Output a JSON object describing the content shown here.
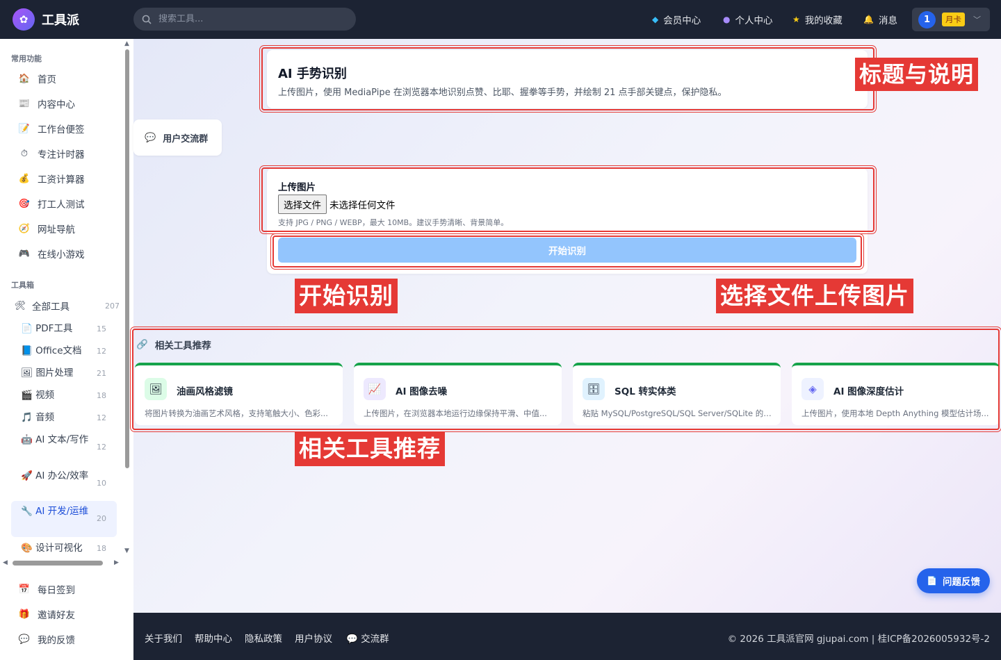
{
  "header": {
    "logo_text": "工具派",
    "search_placeholder": "搜索工具...",
    "nav": [
      {
        "label": "会员中心",
        "icon": "diamond-icon"
      },
      {
        "label": "个人中心",
        "icon": "user-icon"
      },
      {
        "label": "我的收藏",
        "icon": "star-icon"
      },
      {
        "label": "消息",
        "icon": "bell-icon"
      }
    ],
    "user_avatar": "1",
    "user_badge": "月卡"
  },
  "sidebar": {
    "common_title": "常用功能",
    "common": [
      {
        "label": "首页",
        "icon": "🏠"
      },
      {
        "label": "内容中心",
        "icon": "📰"
      },
      {
        "label": "工作台便签",
        "icon": "📝"
      },
      {
        "label": "专注计时器",
        "icon": "⏱"
      },
      {
        "label": "工资计算器",
        "icon": "💰"
      },
      {
        "label": "打工人测试",
        "icon": "🎯"
      },
      {
        "label": "网址导航",
        "icon": "🧭"
      },
      {
        "label": "在线小游戏",
        "icon": "🎮"
      }
    ],
    "toolbox_title": "工具箱",
    "all_tools": {
      "label": "全部工具",
      "count": "207",
      "icon": "🛠"
    },
    "categories": [
      {
        "label": "PDF工具",
        "count": "15",
        "icon": "📄"
      },
      {
        "label": "Office文档",
        "count": "12",
        "icon": "📘"
      },
      {
        "label": "图片处理",
        "count": "21",
        "icon": "🖼"
      },
      {
        "label": "视频",
        "count": "18",
        "icon": "🎬"
      },
      {
        "label": "音频",
        "count": "12",
        "icon": "🎵"
      },
      {
        "label": "AI 文本/写作",
        "count": "12",
        "icon": "🤖"
      },
      {
        "label": "AI 办公/效率",
        "count": "10",
        "icon": "🚀"
      },
      {
        "label": "AI 开发/运维",
        "count": "20",
        "icon": "🔧"
      },
      {
        "label": "设计可视化",
        "count": "18",
        "icon": "🎨"
      }
    ],
    "bottom": [
      {
        "label": "每日签到",
        "icon": "📅"
      },
      {
        "label": "邀请好友",
        "icon": "🎁"
      },
      {
        "label": "我的反馈",
        "icon": "💬"
      }
    ]
  },
  "tool": {
    "title": "AI 手势识别",
    "description": "上传图片，使用 MediaPipe 在浏览器本地识别点赞、比耶、握拳等手势，并绘制 21 点手部关键点，保护隐私。",
    "group_button": "用户交流群",
    "upload_label": "上传图片",
    "file_button": "选择文件",
    "file_status": "未选择任何文件",
    "upload_hint": "支持 JPG / PNG / WEBP，最大 10MB。建议手势清晰、背景简单。",
    "start_button": "开始识别"
  },
  "annotations": {
    "title_desc": "标题与说明",
    "start": "开始识别",
    "upload": "选择文件上传图片",
    "related": "相关工具推荐"
  },
  "related": {
    "heading": "相关工具推荐",
    "items": [
      {
        "name": "油画风格滤镜",
        "desc": "将图片转换为油画艺术风格，支持笔触大小、色彩...",
        "icon": "🖼"
      },
      {
        "name": "AI 图像去噪",
        "desc": "上传图片，在浏览器本地运行边缘保持平滑、中值...",
        "icon": "📈"
      },
      {
        "name": "SQL 转实体类",
        "desc": "粘贴 MySQL/PostgreSQL/SQL Server/SQLite 的 CR...",
        "icon": "🗄"
      },
      {
        "name": "AI 图像深度估计",
        "desc": "上传图片，使用本地 Depth Anything 模型估计场...",
        "icon": "◈"
      }
    ]
  },
  "footer": {
    "links": [
      "关于我们",
      "帮助中心",
      "隐私政策",
      "用户协议",
      "交流群"
    ],
    "copyright": "© 2026 工具派官网 gjupai.com | 桂ICP备2026005932号-2"
  },
  "feedback_button": "问题反馈",
  "colors": {
    "topbar": "#1c2333",
    "accent": "#2563eb",
    "annotation": "#e53935",
    "card_top": "#16a34a"
  }
}
